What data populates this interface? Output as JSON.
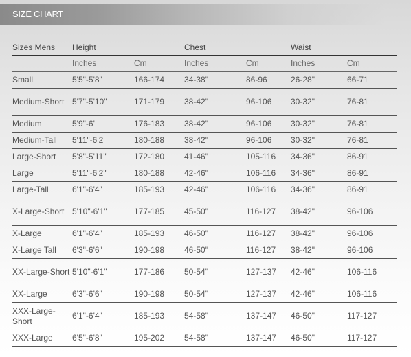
{
  "header": {
    "title": "SIZE CHART"
  },
  "table": {
    "group_headers": [
      "Sizes Mens",
      "Height",
      "",
      "Chest",
      "",
      "Waist",
      ""
    ],
    "sub_headers": [
      "",
      "Inches",
      "Cm",
      "Inches",
      "Cm",
      "Inches",
      "Cm"
    ],
    "rows": [
      [
        "Small",
        "5'5\"-5'8\"",
        "166-174",
        "34-38\"",
        "86-96",
        "26-28\"",
        "66-71"
      ],
      [
        "Medium-Short",
        "5'7\"-5'10\"",
        "171-179",
        "38-42\"",
        "96-106",
        "30-32\"",
        "76-81"
      ],
      [
        "Medium",
        "5'9\"-6'",
        "176-183",
        "38-42\"",
        "96-106",
        "30-32\"",
        "76-81"
      ],
      [
        "Medium-Tall",
        "5'11\"-6'2",
        "180-188",
        "38-42\"",
        "96-106",
        "30-32\"",
        "76-81"
      ],
      [
        "Large-Short",
        "5'8\"-5'11\"",
        "172-180",
        "41-46\"",
        "105-116",
        "34-36\"",
        "86-91"
      ],
      [
        "Large",
        "5'11\"-6'2\"",
        "180-188",
        "42-46\"",
        "106-116",
        "34-36\"",
        "86-91"
      ],
      [
        "Large-Tall",
        "6'1\"-6'4\"",
        "185-193",
        "42-46\"",
        "106-116",
        "34-36\"",
        "86-91"
      ],
      [
        "X-Large-Short",
        "5'10\"-6'1\"",
        "177-185",
        "45-50\"",
        "116-127",
        "38-42\"",
        "96-106"
      ],
      [
        "X-Large",
        "6'1\"-6'4\"",
        "185-193",
        "46-50\"",
        "116-127",
        "38-42\"",
        "96-106"
      ],
      [
        "X-Large Tall",
        "6'3\"-6'6\"",
        "190-198",
        "46-50\"",
        "116-127",
        "38-42\"",
        "96-106"
      ],
      [
        "XX-Large-Short",
        "5'10\"-6'1\"",
        "177-186",
        "50-54\"",
        "127-137",
        "42-46\"",
        "106-116"
      ],
      [
        "XX-Large",
        "6'3\"-6'6\"",
        "190-198",
        "50-54\"",
        "127-137",
        "42-46\"",
        "106-116"
      ],
      [
        "XXX-Large-Short",
        "6'1\"-6'4\"",
        "185-193",
        "54-58\"",
        "137-147",
        "46-50\"",
        "117-127"
      ],
      [
        "XXX-Large",
        "6'5\"-6'8\"",
        "195-202",
        "54-58\"",
        "137-147",
        "46-50\"",
        "117-127"
      ]
    ]
  }
}
